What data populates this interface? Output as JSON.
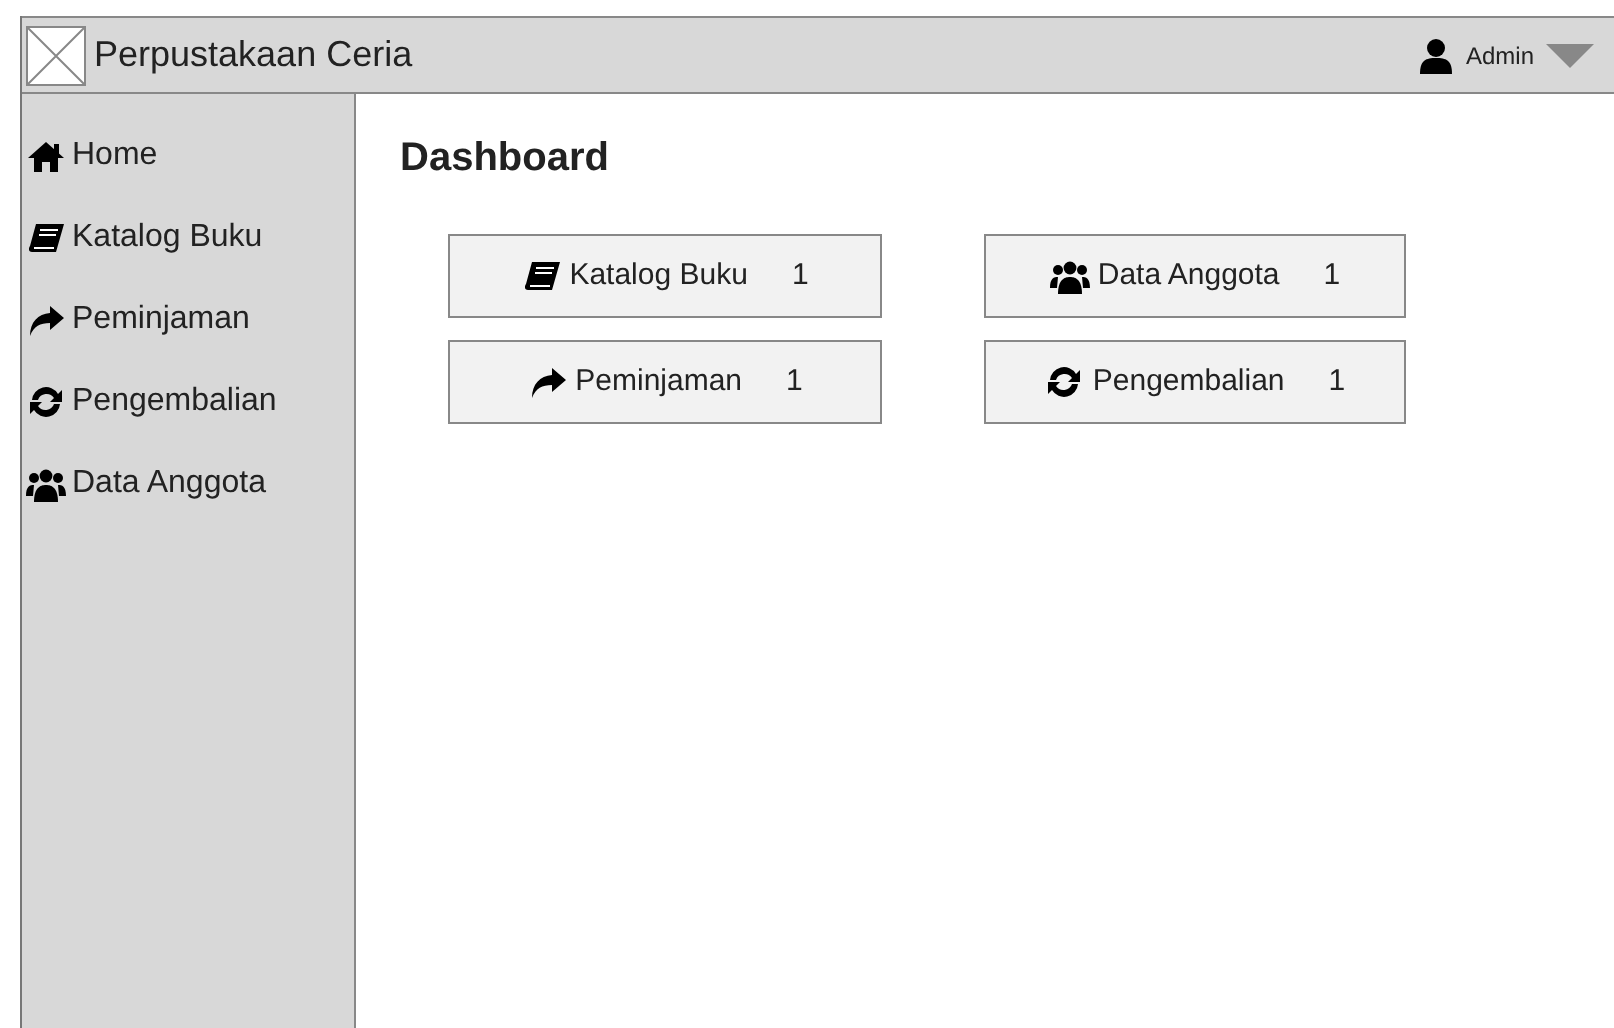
{
  "header": {
    "title": "Perpustakaan Ceria",
    "user": "Admin"
  },
  "sidebar": {
    "items": [
      {
        "label": "Home",
        "kind": "home"
      },
      {
        "label": "Katalog Buku",
        "kind": "book"
      },
      {
        "label": "Peminjaman",
        "kind": "share"
      },
      {
        "label": "Pengembalian",
        "kind": "refresh"
      },
      {
        "label": "Data Anggota",
        "kind": "users"
      }
    ]
  },
  "main": {
    "heading": "Dashboard",
    "cards": [
      {
        "label": "Katalog Buku",
        "count": "1",
        "kind": "book"
      },
      {
        "label": "Data Anggota",
        "count": "1",
        "kind": "users"
      },
      {
        "label": "Peminjaman",
        "count": "1",
        "kind": "share"
      },
      {
        "label": "Pengembalian",
        "count": "1",
        "kind": "refresh"
      }
    ]
  }
}
